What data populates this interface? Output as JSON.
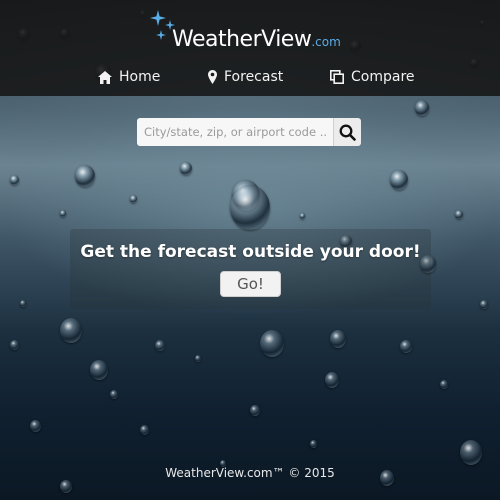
{
  "brand": {
    "name": "WeatherView",
    "suffix": ".com",
    "accent_color": "#5aaee8",
    "icon": "sparkle-icon"
  },
  "nav": {
    "items": [
      {
        "label": "Home",
        "icon": "home-icon"
      },
      {
        "label": "Forecast",
        "icon": "map-pin-icon"
      },
      {
        "label": "Compare",
        "icon": "copy-icon"
      }
    ]
  },
  "search": {
    "placeholder": "City/state, zip, or airport code ...",
    "value": "",
    "button_icon": "search-icon"
  },
  "hero": {
    "title": "Get the forecast outside your door!",
    "button_label": "Go!"
  },
  "footer": {
    "text": "WeatherView.com™ © 2015"
  }
}
